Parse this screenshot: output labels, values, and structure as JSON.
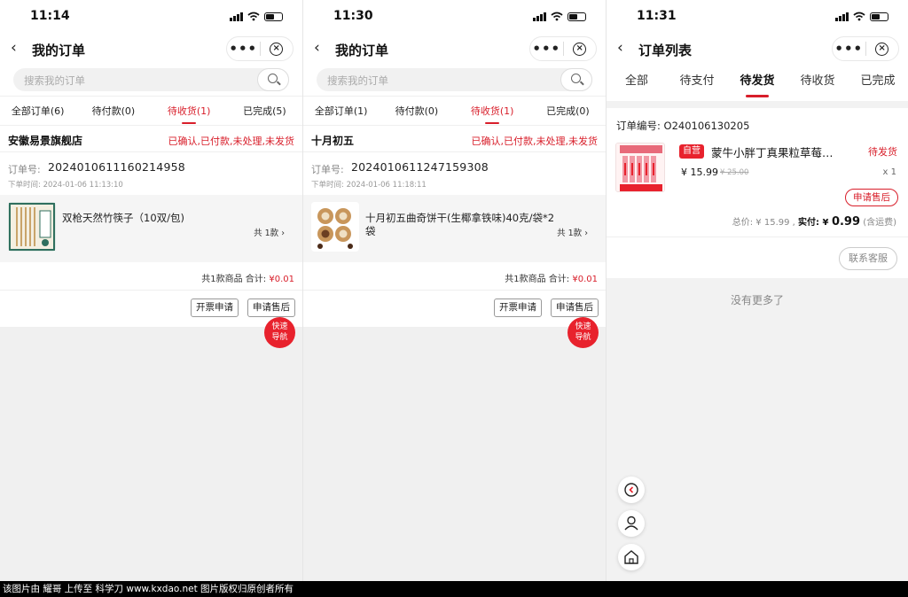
{
  "panel1": {
    "time": "11:14",
    "title": "我的订单",
    "more": "•••",
    "close": "×",
    "search_placeholder": "搜索我的订单",
    "tabs": [
      "全部订单(6)",
      "待付款(0)",
      "待收货(1)",
      "已完成(5)"
    ],
    "shop_name": "安徽易景旗舰店",
    "status": "已确认,已付款,未处理,未发货",
    "orderno_label": "订单号:",
    "orderno": "2024010611160214958",
    "order_time": "下单时间: 2024-01-06 11:13:10",
    "product_name": "双枪天然竹筷子（10双/包)",
    "qty": "共 1款 ›",
    "summary_prefix": "共1款商品 合计: ",
    "summary_amount": "¥0.01",
    "invoice_btn": "开票申请",
    "aftersale_btn": "申请售后",
    "quick_nav_1": "快速",
    "quick_nav_2": "导航"
  },
  "panel2": {
    "time": "11:30",
    "title": "我的订单",
    "more": "•••",
    "close": "×",
    "search_placeholder": "搜索我的订单",
    "tabs": [
      "全部订单(1)",
      "待付款(0)",
      "待收货(1)",
      "已完成(0)"
    ],
    "shop_name": "十月初五",
    "status": "已确认,已付款,未处理,未发货",
    "orderno_label": "订单号:",
    "orderno": "2024010611247159308",
    "order_time": "下单时间: 2024-01-06 11:18:11",
    "product_name": "十月初五曲奇饼干(生椰拿铁味)40克/袋*2袋",
    "qty": "共 1款 ›",
    "summary_prefix": "共1款商品 合计: ",
    "summary_amount": "¥0.01",
    "invoice_btn": "开票申请",
    "aftersale_btn": "申请售后",
    "quick_nav_1": "快速",
    "quick_nav_2": "导航"
  },
  "panel3": {
    "time": "11:31",
    "title": "订单列表",
    "more": "•••",
    "close": "×",
    "tabs": [
      "全部",
      "待支付",
      "待发货",
      "待收货",
      "已完成"
    ],
    "orderno": "订单编号:  O240106130205",
    "badge": "自营",
    "product_name": "蒙牛小胖丁真果粒草莓…",
    "status": "待发货",
    "price": "¥ 15.99",
    "old_price": "¥ 25.00",
    "qty": "x 1",
    "aftersale_btn": "申请售后",
    "total_label": "总价: ¥ 15.99 , ",
    "paid_label": "实付: ¥ ",
    "paid_amount": "0.99",
    "freight_note": " (含运费)",
    "service_btn": "联系客服",
    "no_more": "没有更多了"
  },
  "watermark": "该图片由 耀哥 上传至 科学刀 www.kxdao.net 图片版权归原创者所有",
  "colors": {
    "accent": "#d81e2a",
    "quick_nav": "#e8222d"
  }
}
